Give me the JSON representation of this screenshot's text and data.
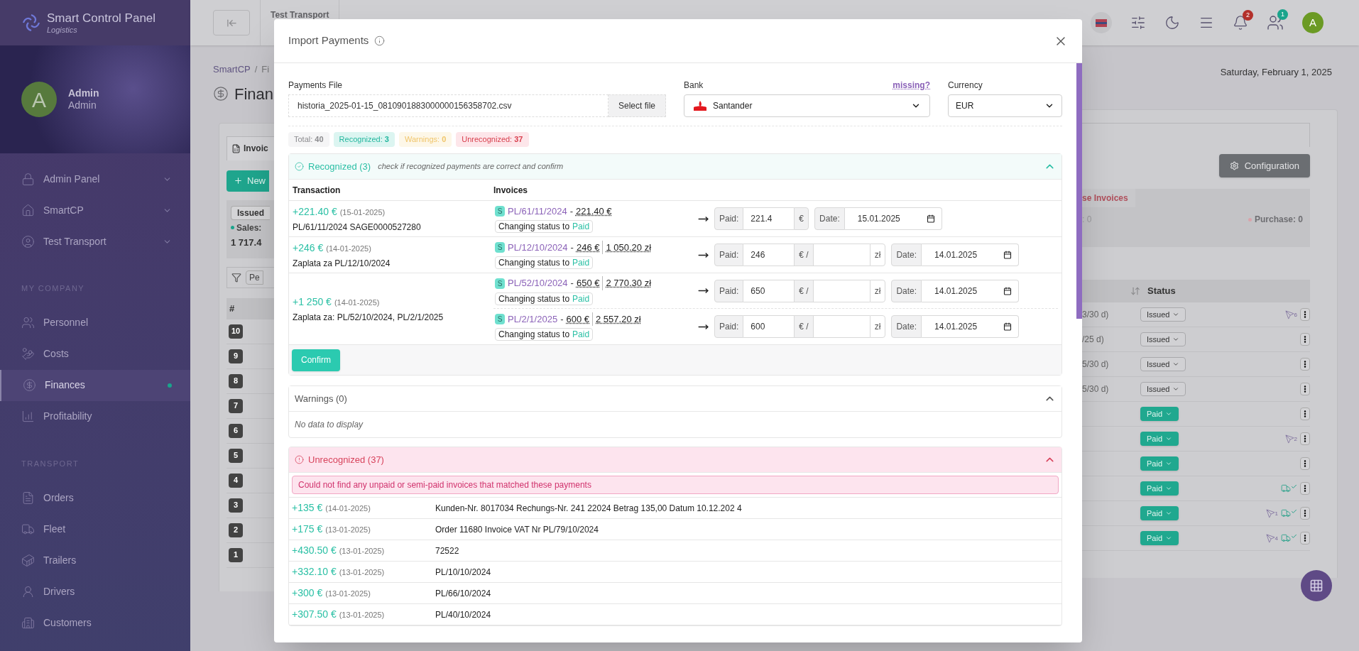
{
  "sidebar": {
    "brand": {
      "title": "Smart Control Panel",
      "subtitle": "Logistics"
    },
    "user": {
      "avatar": "A",
      "name": "Admin",
      "role": "Admin"
    },
    "groups": [
      {
        "items": [
          {
            "label": "Admin Panel",
            "expandable": true,
            "selected": false
          },
          {
            "label": "SmartCP",
            "expandable": true,
            "selected": false
          },
          {
            "label": "Test Transport",
            "expandable": true,
            "selected": false
          }
        ]
      },
      {
        "title": "MY COMPANY",
        "items": [
          {
            "label": "Personnel",
            "expandable": false,
            "selected": false
          },
          {
            "label": "Costs",
            "expandable": false,
            "selected": false
          },
          {
            "label": "Finances",
            "expandable": false,
            "selected": true
          },
          {
            "label": "Profitability",
            "expandable": false,
            "selected": false
          }
        ]
      },
      {
        "title": "TRANSPORT",
        "items": [
          {
            "label": "Orders",
            "expandable": false,
            "selected": false
          },
          {
            "label": "Fleet",
            "expandable": false,
            "selected": false
          },
          {
            "label": "Trailers",
            "expandable": false,
            "selected": false
          },
          {
            "label": "Drivers",
            "expandable": false,
            "selected": false
          },
          {
            "label": "Customers",
            "expandable": false,
            "selected": false
          }
        ]
      }
    ]
  },
  "topbar": {
    "tab": "Test Transport",
    "notifications": "2",
    "users": "1",
    "avatar": "A"
  },
  "page": {
    "breadcrumb": [
      "SmartCP",
      "/",
      "Fi"
    ],
    "heading": "Finan",
    "date": "Saturday, February 1, 2025",
    "tab": "Invoic",
    "new_button": "New",
    "issued_chip": "Issued",
    "sales": "Sales:",
    "sales_value": "1 717.4",
    "filter_chip": "Pe",
    "configuration": "Configuration",
    "purchase_tab": "se Invoices",
    "sales_count": ": 0",
    "purchase": "Purchase: 0",
    "columns": [
      "#",
      "Status"
    ],
    "rows": [
      {
        "number": "10",
        "term": "3/30 d)",
        "status": "Issued",
        "kind": "issued",
        "sent": "6",
        "delivered": false
      },
      {
        "number": "9",
        "term": "/25 d)",
        "status": "Issued",
        "kind": "issued",
        "delivered": false
      },
      {
        "number": "8",
        "term": "5/30 d)",
        "status": "Issued",
        "kind": "issued",
        "delivered": false
      },
      {
        "number": "7",
        "term": "5/30 d)",
        "status": "Issued",
        "kind": "issued",
        "delivered": false
      },
      {
        "number": "6",
        "status": "Paid",
        "kind": "paid",
        "delivered": false
      },
      {
        "number": "5",
        "status": "Paid",
        "kind": "paid",
        "sent": "2",
        "delivered": false
      },
      {
        "number": "4",
        "status": "Paid",
        "kind": "paid",
        "delivered": false
      },
      {
        "number": "3",
        "status": "Paid",
        "kind": "paid",
        "delivered": true
      },
      {
        "number": "2",
        "status": "Paid",
        "kind": "paid",
        "sent": "1",
        "delivered": true
      },
      {
        "number": "1",
        "status": "Paid",
        "kind": "paid",
        "sent": "4",
        "delivered": true
      }
    ]
  },
  "modal": {
    "title": "Import Payments",
    "file": {
      "label": "Payments File",
      "value": "historia_2025-01-15_0810901883000000156358702.csv",
      "button": "Select file"
    },
    "bank": {
      "label": "Bank",
      "link": "missing?",
      "value": "Santander"
    },
    "currency": {
      "label": "Currency",
      "value": "EUR"
    },
    "stats": [
      {
        "kind": "total",
        "text": "Total: **40**"
      },
      {
        "kind": "success",
        "text": "Recognized: **3**"
      },
      {
        "kind": "warning",
        "text": "Warnings: **0**"
      },
      {
        "kind": "danger",
        "text": "Unrecognized: **37**"
      }
    ],
    "recognized": {
      "title": "Recognized (3)",
      "hint": "check if recognized payments are correct and confirm",
      "expanded": true,
      "columns": [
        "Transaction",
        "Invoices"
      ],
      "confirm": "Confirm",
      "transactions": [
        {
          "amount": "+221.40 €",
          "date": "(15-01-2025)",
          "description": "PL/61/11/2024 SAGE0000527280",
          "invoices": [
            {
              "type": "S",
              "number": "PL/61/11/2024",
              "separator": "-",
              "amount": "221.40 €",
              "status_prefix": "Changing status to",
              "status": "Paid",
              "paid_label": "Paid:",
              "paid": "221.4",
              "unit": "€",
              "date_label": "Date:",
              "date": "15.01.2025"
            }
          ]
        },
        {
          "amount": "+246 €",
          "date": "(14-01-2025)",
          "description": "Zaplata za PL/12/10/2024",
          "invoices": [
            {
              "type": "S",
              "number": "PL/12/10/2024",
              "separator": "-",
              "amount": "246 €",
              "amount_pln": "1 050.20 zł",
              "status_prefix": "Changing status to",
              "status": "Paid",
              "paid_label": "Paid:",
              "paid": "246",
              "unit": "€ /",
              "pln_unit": "zł",
              "date_label": "Date:",
              "date": "14.01.2025"
            }
          ]
        },
        {
          "amount": "+1 250 €",
          "date": "(14-01-2025)",
          "description": "Zaplata za: PL/52/10/2024, PL/2/1/2025",
          "invoices": [
            {
              "type": "S",
              "number": "PL/52/10/2024",
              "separator": "-",
              "amount": "650 €",
              "amount_pln": "2 770.30 zł",
              "status_prefix": "Changing status to",
              "status": "Paid",
              "paid_label": "Paid:",
              "paid": "650",
              "unit": "€ /",
              "pln_unit": "zł",
              "date_label": "Date:",
              "date": "14.01.2025"
            },
            {
              "type": "S",
              "number": "PL/2/1/2025",
              "separator": "-",
              "amount": "600 €",
              "amount_pln": "2 557.20 zł",
              "status_prefix": "Changing status to",
              "status": "Paid",
              "paid_label": "Paid:",
              "paid": "600",
              "unit": "€ /",
              "pln_unit": "zł",
              "date_label": "Date:",
              "date": "14.01.2025"
            }
          ]
        }
      ]
    },
    "warnings": {
      "title": "Warnings (0)",
      "expanded": true,
      "empty": "No data to display"
    },
    "unrecognized": {
      "title": "Unrecognized (37)",
      "expanded": true,
      "alert": "Could not find any unpaid or semi-paid invoices that matched these payments",
      "rows": [
        {
          "amount": "+135 €",
          "date": "(14-01-2025)",
          "description": "Kunden-Nr. 8017034 Rechungs-Nr. 241 22024 Betrag 135,00 Datum 10.12.202 4"
        },
        {
          "amount": "+175 €",
          "date": "(13-01-2025)",
          "description": "Order 11680 Invoice VAT Nr PL/79/10/2024"
        },
        {
          "amount": "+430.50 €",
          "date": "(13-01-2025)",
          "description": "72522"
        },
        {
          "amount": "+332.10 €",
          "date": "(13-01-2025)",
          "description": "PL/10/10/2024"
        },
        {
          "amount": "+300 €",
          "date": "(13-01-2025)",
          "description": "PL/66/10/2024"
        },
        {
          "amount": "+307.50 €",
          "date": "(13-01-2025)",
          "description": "PL/40/10/2024"
        }
      ]
    }
  }
}
